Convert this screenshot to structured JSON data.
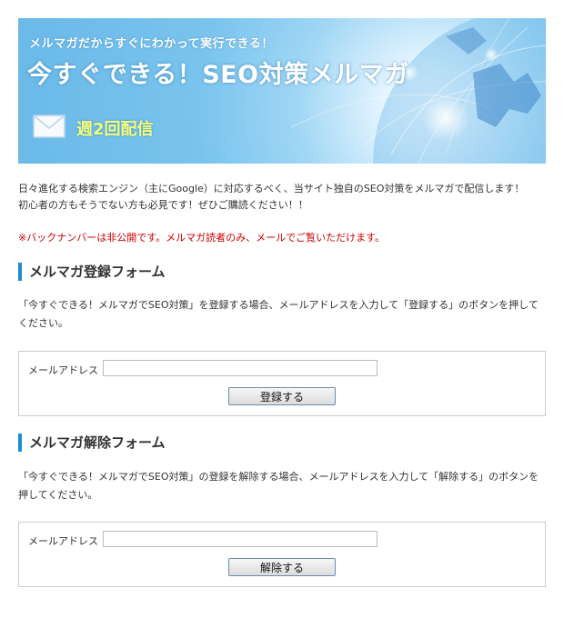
{
  "banner": {
    "subtitle": "メルマガだからすぐにわかって実行できる！",
    "title": "今すぐできる！SEO対策メルマガ",
    "frequency": "週2回配信"
  },
  "intro": {
    "line1": "日々進化する検索エンジン（主にGoogle）に対応するべく、当サイト独自のSEO対策をメルマガで配信します！",
    "line2": "初心者の方もそうでない方も必見です！ぜひご購読ください！！"
  },
  "notice": "※バックナンバーは非公開です。メルマガ読者のみ、メールでご覧いただけます。",
  "register": {
    "heading": "メルマガ登録フォーム",
    "description": "「今すぐできる！メルマガでSEO対策」を登録する場合、メールアドレスを入力して「登録する」のボタンを押してください。",
    "email_label": "メールアドレス",
    "email_value": "",
    "button_label": "登録する"
  },
  "unregister": {
    "heading": "メルマガ解除フォーム",
    "description": "「今すぐできる！メルマガでSEO対策」の登録を解除する場合、メールアドレスを入力して「解除する」のボタンを押してください。",
    "email_label": "メールアドレス",
    "email_value": "",
    "button_label": "解除する"
  },
  "colors": {
    "accent": "#1a8fd0",
    "notice": "#cc0000",
    "banner_sky": "#79c4ee",
    "frequency_text": "#f6ff7a"
  },
  "icons": {
    "banner_mail": "envelope-icon",
    "banner_graphic": "globe-network-graphic"
  }
}
